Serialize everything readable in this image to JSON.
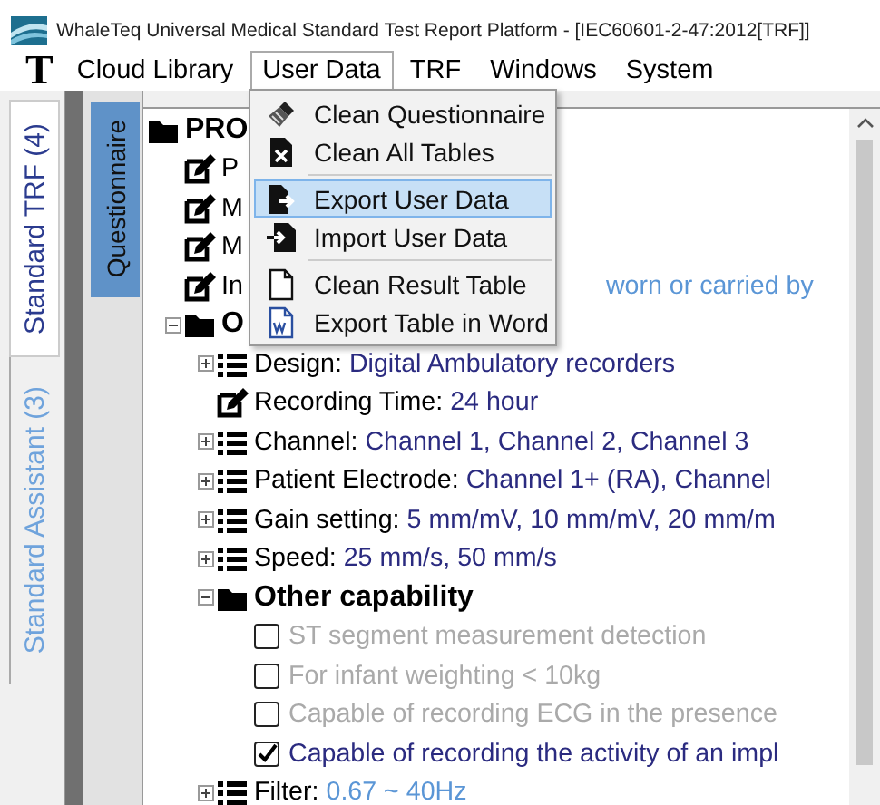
{
  "window": {
    "title": "WhaleTeq Universal Medical Standard Test Report Platform - [IEC60601-2-47:2012[TRF]]"
  },
  "menu_bar": {
    "logo": "T",
    "items": [
      {
        "label": "Cloud Library",
        "open": false
      },
      {
        "label": "User Data",
        "open": true
      },
      {
        "label": "TRF",
        "open": false
      },
      {
        "label": "Windows",
        "open": false
      },
      {
        "label": "System",
        "open": false
      }
    ]
  },
  "dropdown": {
    "items": [
      {
        "kind": "item",
        "label": "Clean Questionnaire",
        "selected": false
      },
      {
        "kind": "item",
        "label": "Clean All Tables",
        "selected": false
      },
      {
        "kind": "separator"
      },
      {
        "kind": "item",
        "label": "Export User Data",
        "selected": true
      },
      {
        "kind": "item",
        "label": "Import User Data",
        "selected": false
      },
      {
        "kind": "separator"
      },
      {
        "kind": "item",
        "label": "Clean Result Table",
        "selected": false
      },
      {
        "kind": "item",
        "label": "Export Table in Word",
        "selected": false
      }
    ]
  },
  "side_tabs": [
    {
      "label": "Standard TRF (4)",
      "selected": true
    },
    {
      "label": "Standard Assistant (3)",
      "selected": false
    }
  ],
  "panel_tab": {
    "label": "Questionnaire"
  },
  "tree": [
    {
      "kind": "folder",
      "label": "PRO",
      "children": [
        {
          "kind": "field",
          "label": "P"
        },
        {
          "kind": "field",
          "label": "M"
        },
        {
          "kind": "field",
          "label": "M"
        },
        {
          "kind": "field",
          "label": "In",
          "value": "worn or carried by",
          "confirmed": false,
          "value_partial": true
        },
        {
          "kind": "folder",
          "label": "O",
          "expanded": true,
          "children": [
            {
              "kind": "list",
              "label": "Design:",
              "value": "Digital Ambulatory recorders",
              "confirmed": true,
              "expanded": false
            },
            {
              "kind": "field",
              "label": "Recording Time:",
              "value": "24 hour",
              "confirmed": true
            },
            {
              "kind": "list",
              "label": "Channel:",
              "value": "Channel 1, Channel 2, Channel 3",
              "confirmed": true,
              "expanded": false
            },
            {
              "kind": "list",
              "label": "Patient Electrode:",
              "value": "Channel 1+ (RA), Channel",
              "confirmed": true,
              "expanded": false
            },
            {
              "kind": "list",
              "label": "Gain setting:",
              "value": "5 mm/mV, 10 mm/mV, 20 mm/m",
              "confirmed": true,
              "expanded": false
            },
            {
              "kind": "list",
              "label": "Speed:",
              "value": "25 mm/s, 50 mm/s",
              "confirmed": true,
              "expanded": false
            },
            {
              "kind": "folder",
              "label": "Other capability",
              "expanded": true,
              "children": [
                {
                  "kind": "check",
                  "label": "ST segment measurement detection",
                  "checked": false,
                  "disabled": true
                },
                {
                  "kind": "check",
                  "label": "For infant weighting < 10kg",
                  "checked": false,
                  "disabled": true
                },
                {
                  "kind": "check",
                  "label": "Capable of recording ECG in the presence",
                  "checked": false,
                  "disabled": true
                },
                {
                  "kind": "check",
                  "label": "Capable of recording the activity of an impl",
                  "checked": true,
                  "disabled": false
                }
              ]
            },
            {
              "kind": "list",
              "label": "Filter:",
              "value": "0.67 ~ 40Hz",
              "confirmed": false,
              "expanded": false
            }
          ]
        }
      ]
    }
  ]
}
